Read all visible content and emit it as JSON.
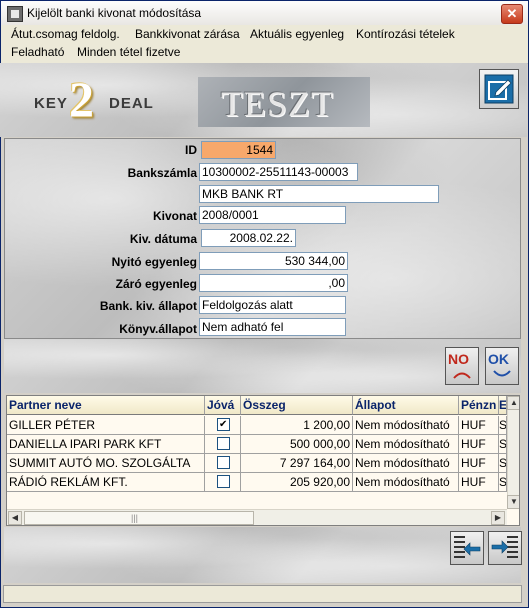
{
  "window": {
    "title": "Kijelölt banki kivonat módosítása",
    "close_symbol": "✕"
  },
  "menu": {
    "items": [
      "Átut.csomag feldolg.",
      "Bankkivonat zárása",
      "Aktuális egyenleg",
      "Kontírozási tételek",
      "Feladható",
      "Minden tétel fizetve"
    ]
  },
  "header": {
    "logo_parts": [
      "KEY",
      "2",
      "DEAL"
    ],
    "banner": "TESZT"
  },
  "form": {
    "id_label": "ID",
    "id_value": "1544",
    "account_label": "Bankszámla",
    "account_value": "10300002-25511143-00003",
    "bank_name_value": "MKB BANK RT",
    "statement_label": "Kivonat",
    "statement_value": "2008/0001",
    "date_label": "Kiv. dátuma",
    "date_value": "2008.02.22.",
    "opening_label": "Nyitó egyenleg",
    "opening_value": "530 344,00",
    "closing_label": "Záró egyenleg",
    "closing_value": ",00",
    "statement_status_label": "Bank. kiv. állapot",
    "statement_status_value": "Feldolgozás alatt",
    "booking_status_label": "Könyv.állapot",
    "booking_status_value": "Nem adható fel"
  },
  "buttons": {
    "no_label": "NO",
    "ok_label": "OK"
  },
  "grid": {
    "columns": [
      "Partner neve",
      "Jóvá",
      "Összeg",
      "Állapot",
      "Pénzn",
      "E"
    ],
    "rows": [
      {
        "partner": "GILLER PÉTER",
        "checked": true,
        "amount": "1 200,00",
        "status": "Nem módosítható",
        "currency": "HUF",
        "extra": "S"
      },
      {
        "partner": "DANIELLA IPARI PARK KFT",
        "checked": false,
        "amount": "500 000,00",
        "status": "Nem módosítható",
        "currency": "HUF",
        "extra": "S"
      },
      {
        "partner": "SUMMIT AUTÓ MO. SZOLGÁLTA",
        "checked": false,
        "amount": "7 297 164,00",
        "status": "Nem módosítható",
        "currency": "HUF",
        "extra": "S"
      },
      {
        "partner": "RÁDIÓ REKLÁM KFT.",
        "checked": false,
        "amount": "205 920,00",
        "status": "Nem módosítható",
        "currency": "HUF",
        "extra": "S"
      }
    ]
  },
  "colors": {
    "id_field_bg": "#f7a86b",
    "grid_header_text": "#0a246a",
    "grid_bg": "#fffaf0"
  }
}
